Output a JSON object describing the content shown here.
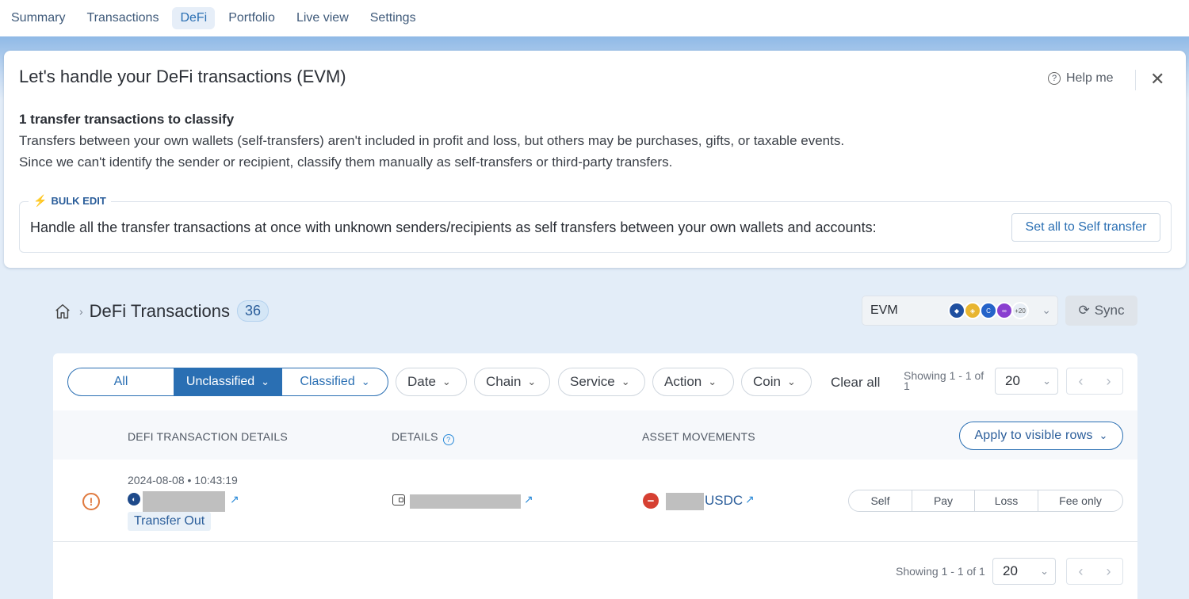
{
  "nav": {
    "tabs": [
      {
        "label": "Summary"
      },
      {
        "label": "Transactions"
      },
      {
        "label": "DeFi"
      },
      {
        "label": "Portfolio"
      },
      {
        "label": "Live view"
      },
      {
        "label": "Settings"
      }
    ],
    "active": "DeFi"
  },
  "panel": {
    "title": "Let's handle your DeFi transactions (EVM)",
    "help_label": "Help me",
    "subheading": "1 transfer transactions to classify",
    "desc_line1": "Transfers between your own wallets (self-transfers) aren't included in profit and loss, but others may be purchases, gifts, or taxable events.",
    "desc_line2": "Since we can't identify the sender or recipient, classify them manually as self-transfers or third-party transfers.",
    "bulk_tag": "BULK EDIT",
    "bulk_text": "Handle all the transfer transactions at once with unknown senders/recipients as self transfers between your own wallets and accounts:",
    "bulk_button": "Set all to Self transfer"
  },
  "breadcrumb": {
    "title": "DeFi Transactions",
    "count": "36"
  },
  "network_select": {
    "label": "EVM",
    "more_badge": "+20",
    "coin_icons": [
      "ethereum-icon",
      "bnb-icon",
      "celo-icon",
      "polygon-icon"
    ]
  },
  "sync_label": "Sync",
  "filters": {
    "segments": [
      "All",
      "Unclassified",
      "Classified"
    ],
    "pills": [
      "Date",
      "Chain",
      "Service",
      "Action",
      "Coin"
    ],
    "clear_all": "Clear all",
    "showing_top": "Showing 1 - 1 of 1",
    "per_page": "20"
  },
  "table": {
    "headers": {
      "details": "DEFI TRANSACTION DETAILS",
      "details2": "DETAILS",
      "assets": "ASSET MOVEMENTS"
    },
    "apply_button": "Apply to visible rows",
    "rows": [
      {
        "timestamp": "2024-08-08 • 10:43:19",
        "type_badge": "Transfer Out",
        "asset": "USDC",
        "options": [
          "Self",
          "Pay",
          "Loss",
          "Fee only"
        ]
      }
    ]
  },
  "footer": {
    "showing": "Showing 1 - 1 of 1",
    "per_page": "20"
  },
  "colors": {
    "accent": "#2a6fb3",
    "warning": "#e07a3f",
    "outflow": "#d64032"
  }
}
